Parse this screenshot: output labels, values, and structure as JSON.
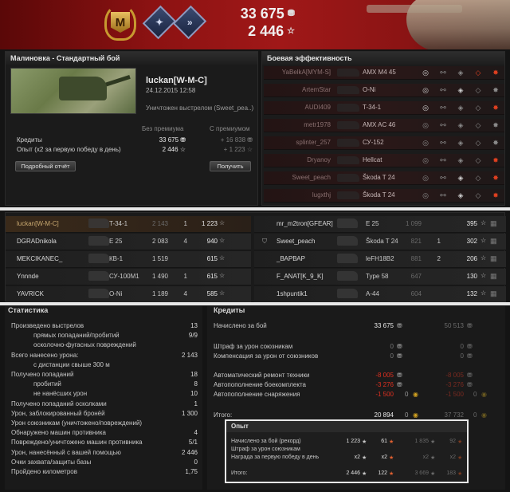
{
  "header": {
    "medal_letter": "M",
    "credits_total": "33 675",
    "xp_total": "2 446",
    "credits_icon": "credits-icon",
    "xp_icon": "star-icon"
  },
  "result": {
    "title": "Малиновка - Стандартный бой",
    "player_name": "luckan[W-M-C]",
    "date": "24.12.2015 12:58",
    "killed_by": "Уничтожен выстрелом (Sweet_pea..)",
    "col_without": "Без премиума",
    "col_with": "С премиумом",
    "rows": [
      {
        "label": "Кредиты",
        "v1": "33 675",
        "v2": "+ 16 838"
      },
      {
        "label": "Опыт  (x2 за первую победу в день)",
        "v1": "2 446",
        "v2": "+ 1 223"
      }
    ],
    "details_button": "Подробный отчёт",
    "receive_button": "Получить"
  },
  "efficiency": {
    "title": "Боевая эффективность",
    "rows": [
      {
        "name": "YaBelkA[MYM-S]",
        "vehicle": "AMX M4 45"
      },
      {
        "name": "ArtemStar",
        "vehicle": "O-Ni"
      },
      {
        "name": "AUDI409",
        "vehicle": "T-34-1"
      },
      {
        "name": "metr1978",
        "vehicle": "AMX AC 46"
      },
      {
        "name": "splinter_257",
        "vehicle": "СУ-152"
      },
      {
        "name": "Dryanoy",
        "vehicle": "Hellcat"
      },
      {
        "name": "Sweet_peach",
        "vehicle": "Škoda T 24"
      },
      {
        "name": "lugxthj",
        "vehicle": "Škoda T 24"
      }
    ]
  },
  "team_left": [
    {
      "name": "luckan[W-M-C]",
      "vehicle": "T-34-1",
      "damage": "2 143",
      "frags": "1",
      "xp": "1 223"
    },
    {
      "name": "DGRADnikola",
      "vehicle": "E 25",
      "damage": "2 083",
      "frags": "4",
      "xp": "940"
    },
    {
      "name": "MEKCIKANEC_",
      "vehicle": "КВ-1",
      "damage": "1 519",
      "frags": "",
      "xp": "615"
    },
    {
      "name": "Ynnnde",
      "vehicle": "СУ-100М1",
      "damage": "1 490",
      "frags": "1",
      "xp": "615"
    },
    {
      "name": "YAVRICK",
      "vehicle": "O-Ni",
      "damage": "1 189",
      "frags": "4",
      "xp": "585"
    }
  ],
  "team_right": [
    {
      "name": "mr_m2tron[GFEAR]",
      "vehicle": "E 25",
      "damage": "1 099",
      "frags": "",
      "xp": "395"
    },
    {
      "name": "Sweet_peach",
      "vehicle": "Škoda T 24",
      "damage": "821",
      "frags": "1",
      "xp": "302"
    },
    {
      "name": "_ВАРВАР",
      "vehicle": "leFH18B2",
      "damage": "881",
      "frags": "2",
      "xp": "206"
    },
    {
      "name": "F_ANAT[K_9_K]",
      "vehicle": "Type 58",
      "damage": "647",
      "frags": "",
      "xp": "130"
    },
    {
      "name": "1shpuntik1",
      "vehicle": "A-44",
      "damage": "604",
      "frags": "",
      "xp": "132"
    }
  ],
  "stats": {
    "title": "Статистика",
    "rows": [
      {
        "label": "Произведено выстрелов",
        "value": "13",
        "indent": false
      },
      {
        "label": "прямых попаданий/пробитий",
        "value": "9/9",
        "indent": true
      },
      {
        "label": "осколочно-фугасных повреждений",
        "value": "",
        "indent": true
      },
      {
        "label": "Всего нанесено урона:",
        "value": "2 143",
        "indent": false
      },
      {
        "label": "с дистанции свыше 300 м",
        "value": "",
        "indent": true
      },
      {
        "label": "Получено попаданий",
        "value": "18",
        "indent": false
      },
      {
        "label": "пробитий",
        "value": "8",
        "indent": true
      },
      {
        "label": "не нанёсших урон",
        "value": "10",
        "indent": true
      },
      {
        "label": "Получено попаданий осколками",
        "value": "1",
        "indent": false
      },
      {
        "label": "Урон, заблокированный бронёй",
        "value": "1 300",
        "indent": false
      },
      {
        "label": "Урон союзникам (уничтожено/повреждений)",
        "value": "",
        "indent": false
      },
      {
        "label": "Обнаружено машин противника",
        "value": "4",
        "indent": false
      },
      {
        "label": "Повреждено/уничтожено машин противника",
        "value": "5/1",
        "indent": false
      },
      {
        "label": "Урон, нанесённый с вашей помощью",
        "value": "2 446",
        "indent": false
      },
      {
        "label": "Очки захвата/защиты базы",
        "value": "0",
        "indent": false
      },
      {
        "label": "Пройдено километров",
        "value": "1,75",
        "indent": false
      }
    ]
  },
  "credits": {
    "title": "Кредиты",
    "rows": [
      {
        "label": "Начислено за бой",
        "v1": "33 675",
        "v2": "50 513",
        "type": "normal"
      },
      {
        "label": "Штраф за урон союзникам",
        "v1": "0",
        "v2": "0",
        "type": "grey"
      },
      {
        "label": "Компенсация за урон от союзников",
        "v1": "0",
        "v2": "0",
        "type": "grey"
      },
      {
        "label": "Автоматический ремонт техники",
        "v1": "-8 005",
        "v2": "-8 005",
        "type": "red"
      },
      {
        "label": "Автопополнение боекомплекта",
        "v1": "-3 276",
        "v2": "-3 276",
        "type": "red"
      },
      {
        "label": "Автопополнение снаряжения",
        "v1": "-1 500",
        "g1": "0",
        "v2": "-1 500",
        "g2": "0",
        "type": "red"
      },
      {
        "label": "Итого:",
        "v1": "20 894",
        "g1": "0",
        "v2": "37 732",
        "g2": "0",
        "type": "normal"
      }
    ]
  },
  "experience": {
    "title": "Опыт",
    "rows": [
      {
        "label": "Начислено за бой (рекорд)",
        "a": "1 223",
        "b": "61",
        "c": "1 835",
        "d": "92"
      },
      {
        "label": "Штраф за урон союзникам",
        "a": "",
        "b": "",
        "c": "",
        "d": ""
      },
      {
        "label": "Награда за первую победу в день",
        "a": "x2",
        "b": "x2",
        "c": "x2",
        "d": "x2"
      },
      {
        "label": "Итого:",
        "a": "2 446",
        "b": "122",
        "c": "3 669",
        "d": "183"
      }
    ]
  }
}
